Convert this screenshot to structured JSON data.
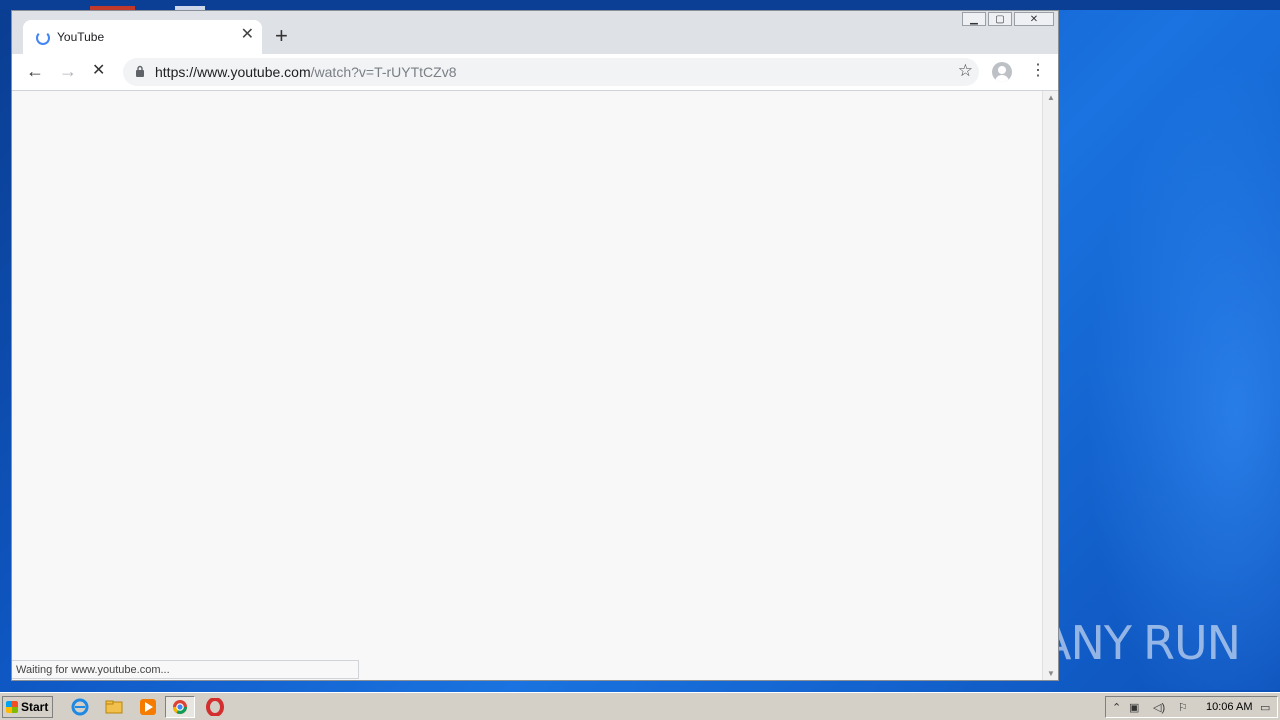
{
  "browser": {
    "tab": {
      "title": "YouTube",
      "close": "✕"
    },
    "new_tab": "+",
    "window_controls": {
      "minimize": "▁",
      "maximize": "▢",
      "close": "✕"
    },
    "nav": {
      "back": "←",
      "forward": "→",
      "stop": "✕"
    },
    "address": {
      "host": "https://www.youtube.com",
      "path": "/watch?v=T-rUYTtCZv8"
    },
    "bookmark": "☆",
    "menu": "⋮",
    "status": "Waiting for www.youtube.com..."
  },
  "watermark": {
    "text": "ANY",
    "text2": "RUN"
  },
  "taskbar": {
    "start": "Start",
    "clock": "10:06 AM",
    "pinned": [
      "internet-explorer-icon",
      "file-explorer-icon",
      "media-player-icon",
      "chrome-icon",
      "opera-icon"
    ]
  },
  "colors": {
    "accent": "#4285f4",
    "desktop": "#0f58c4"
  }
}
